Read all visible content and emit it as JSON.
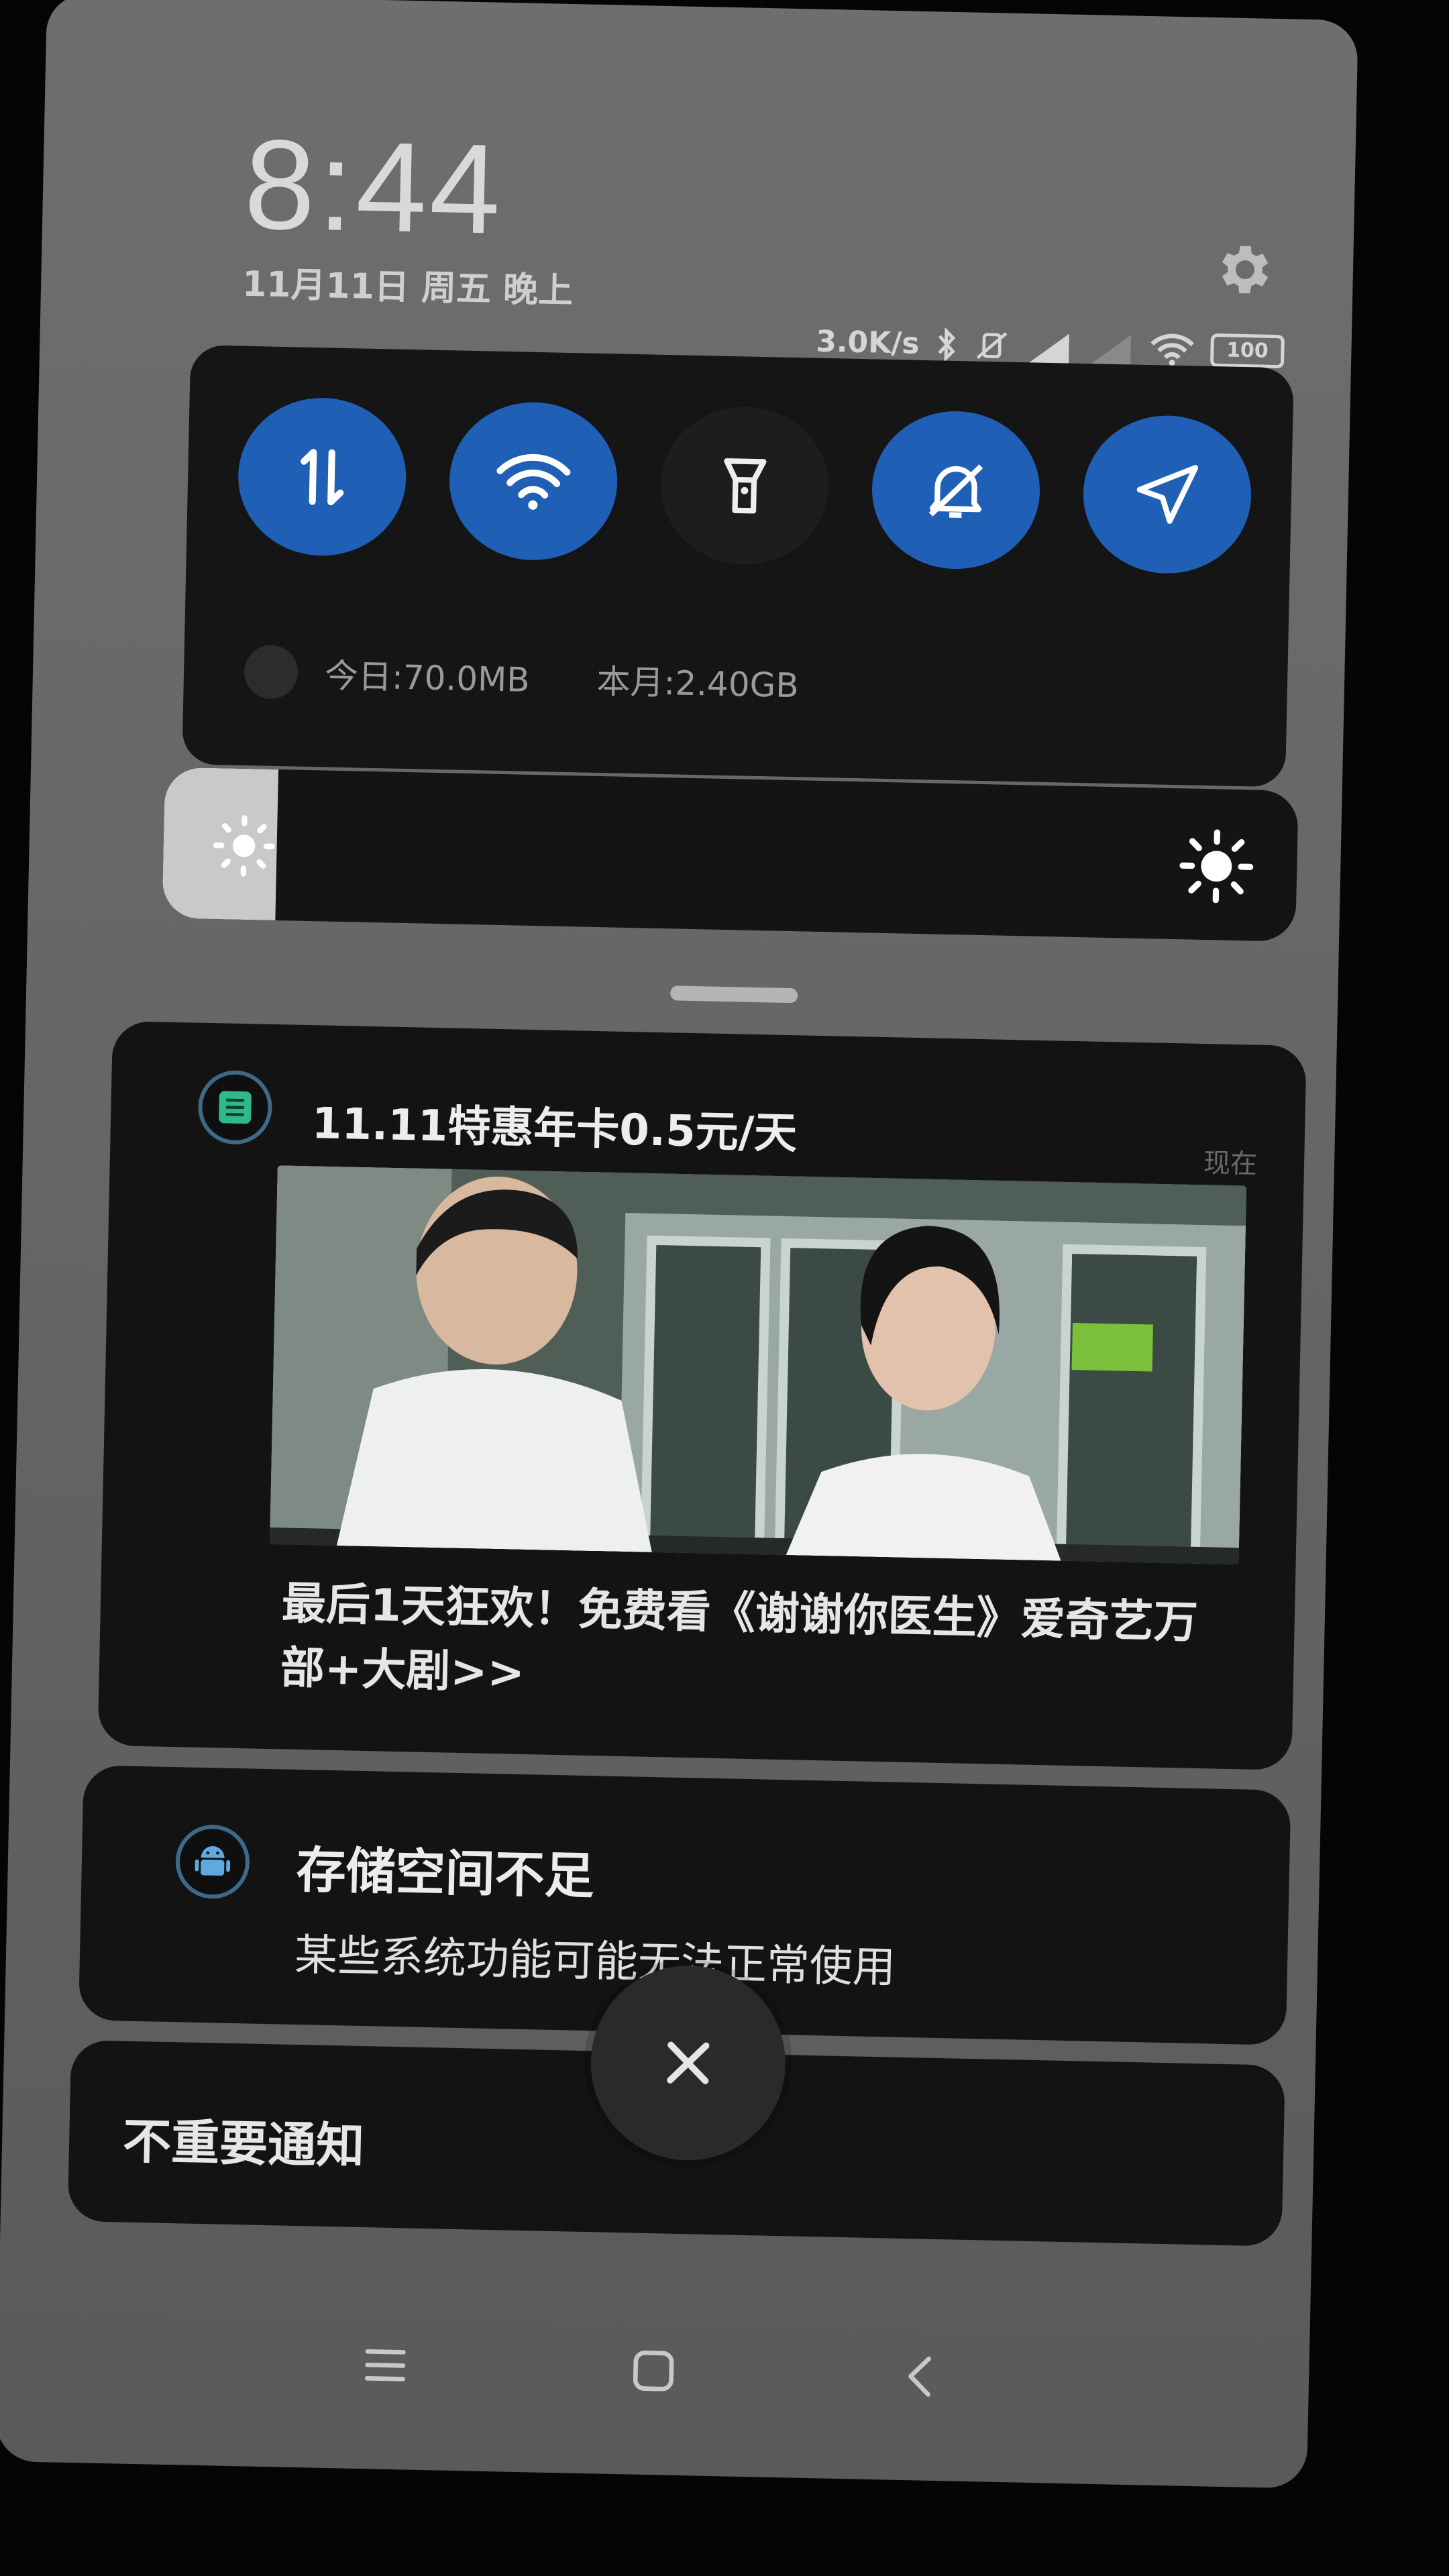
{
  "header": {
    "time": "8:44",
    "date": "11月11日 周五 晚上",
    "network_speed": "3.0K/s",
    "battery": "100"
  },
  "quick_settings": {
    "tiles": [
      {
        "icon": "mobile-data-icon",
        "active": true
      },
      {
        "icon": "wifi-icon",
        "active": true
      },
      {
        "icon": "flashlight-icon",
        "active": false
      },
      {
        "icon": "mute-icon",
        "active": true
      },
      {
        "icon": "location-icon",
        "active": true
      }
    ],
    "data_today": "今日:70.0MB",
    "data_month": "本月:2.40GB"
  },
  "brightness": {
    "level_percent": 10
  },
  "notifications": {
    "promo": {
      "title": "11.11特惠年卡0.5元/天",
      "time": "现在",
      "body": "最后1天狂欢！免费看《谢谢你医生》爱奇艺万部+大剧>>"
    },
    "storage": {
      "title": "存储空间不足",
      "body": "某些系统功能可能无法正常使用"
    },
    "unimportant": {
      "label": "不重要通知"
    }
  },
  "colors": {
    "accent": "#1f5fb5",
    "panel": "#131313",
    "shade": "#666666"
  }
}
